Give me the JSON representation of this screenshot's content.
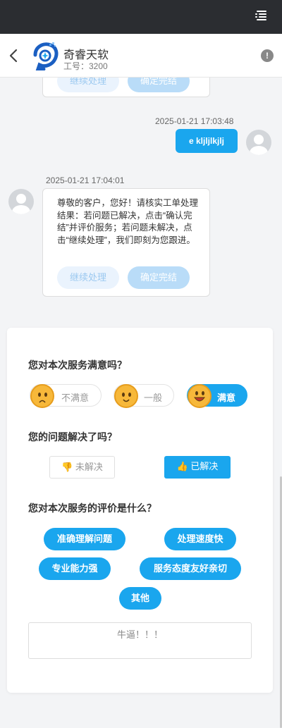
{
  "header": {
    "brand": "奇睿天软",
    "job_no": "工号：3200"
  },
  "chat": {
    "prev_card": {
      "continue_label": "继续处理",
      "confirm_label": "确定完结"
    },
    "my_message": {
      "time": "2025-01-21 17:03:48",
      "text": "e kljljlkjlj"
    },
    "agent_message": {
      "time": "2025-01-21 17:04:01",
      "text": "尊敬的客户，您好！请核实工单处理结果：若问题已解决，点击“确认完结”并评价服务；若问题未解决，点击“继续处理”，我们即刻为您跟进。",
      "continue_label": "继续处理",
      "confirm_label": "确定完结"
    }
  },
  "feedback": {
    "satisfaction": {
      "question": "您对本次服务满意吗？",
      "options": [
        "不满意",
        "一般",
        "满意"
      ],
      "selected": "满意"
    },
    "resolved": {
      "question": "您的问题解决了吗？",
      "options": [
        "👎 未解决",
        "👍 已解决"
      ],
      "selected": "👍 已解决"
    },
    "evaluation": {
      "question": "您对本次服务的评价是什么？",
      "tags": [
        "准确理解问题",
        "处理速度快",
        "专业能力强",
        "服务态度友好亲切",
        "其他"
      ]
    },
    "comment": "牛逼！！！"
  },
  "colors": {
    "accent": "#1aa6ee",
    "topbar": "#2b2d31",
    "emoji": "#f7b83a"
  }
}
